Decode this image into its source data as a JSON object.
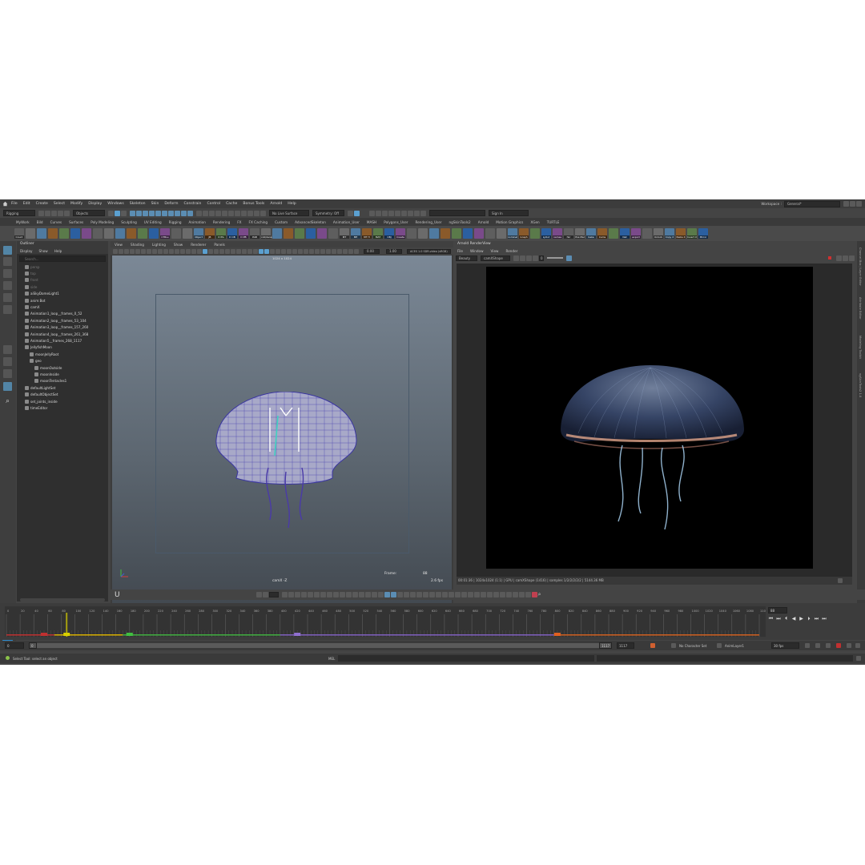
{
  "menubar": {
    "items": [
      "File",
      "Edit",
      "Create",
      "Select",
      "Modify",
      "Display",
      "Windows",
      "Skeleton",
      "Skin",
      "Deform",
      "Constrain",
      "Control",
      "Cache",
      "Bonus Tools",
      "Arnold",
      "Help"
    ],
    "workspace_label": "Workspace :",
    "workspace_value": "General*"
  },
  "statusline": {
    "menuset": "Rigging",
    "objects": "Objects",
    "live_surface": "No Live Surface",
    "symmetry": "Symmetry: Off",
    "sign_in": "Sign In"
  },
  "shelf_tabs": [
    "MyWork",
    "Bild",
    "Curves",
    "Surfaces",
    "Poly Modeling",
    "Sculpting",
    "UV Editing",
    "Rigging",
    "Animation",
    "Rendering",
    "FX",
    "FX Caching",
    "Custom",
    "AdvancedSkeleton",
    "Animation_User",
    "MASH",
    "Polygons_User",
    "Rendering_User",
    "ngSkinTools2",
    "Arnold",
    "Motion Graphics",
    "XGen",
    "TURTLE"
  ],
  "shelf_buttons": [
    "Count",
    "",
    "",
    "",
    "",
    "",
    "",
    "",
    "",
    "",
    "",
    "",
    "",
    "CTRLs",
    "",
    "",
    "Object",
    "JB",
    "D PG",
    "D OB",
    "D PB",
    "PAB",
    "coll/dens",
    "",
    "",
    "",
    "",
    "",
    "",
    "MT",
    "ME",
    "MT H",
    "MAT",
    "OBJ",
    "Create",
    "",
    "",
    "",
    "",
    "",
    "",
    "",
    "",
    "",
    "nominal",
    "Graph",
    "",
    "LyOut",
    "names",
    "hkr",
    "Pos Mel",
    "bake",
    "Cams",
    "",
    "Net",
    "export",
    "",
    "Unlock",
    "Copy X",
    "Paste X",
    "Invert X",
    "Mirror"
  ],
  "outliner": {
    "title": "Outliner",
    "menu": [
      "Display",
      "Show",
      "Help"
    ],
    "search_placeholder": "Search...",
    "items": [
      {
        "label": "persp",
        "dim": true,
        "indent": 1
      },
      {
        "label": "top",
        "dim": true,
        "indent": 1
      },
      {
        "label": "front",
        "dim": true,
        "indent": 1
      },
      {
        "label": "side",
        "dim": true,
        "indent": 1
      },
      {
        "label": "aiSkyDomeLight1",
        "dim": false,
        "indent": 1
      },
      {
        "label": "anim:Bot",
        "dim": false,
        "indent": 1
      },
      {
        "label": "camX",
        "dim": false,
        "indent": 1
      },
      {
        "label": "Animation1_loop__frames_0_52",
        "dim": false,
        "indent": 1
      },
      {
        "label": "Animation2_loop__frames_53_104",
        "dim": false,
        "indent": 1
      },
      {
        "label": "Animation3_loop__frames_157_260",
        "dim": false,
        "indent": 1
      },
      {
        "label": "Animation4_loop__frames_261_368",
        "dim": false,
        "indent": 1
      },
      {
        "label": "Animation5__frames_268_1117",
        "dim": false,
        "indent": 1
      },
      {
        "label": "JellyfishMoon",
        "dim": false,
        "indent": 1
      },
      {
        "label": "moonJellyRoot",
        "dim": false,
        "indent": 2
      },
      {
        "label": "geo",
        "dim": false,
        "indent": 2
      },
      {
        "label": "moonOutside",
        "dim": false,
        "indent": 3
      },
      {
        "label": "moonInside",
        "dim": false,
        "indent": 3
      },
      {
        "label": "moonTentacles1",
        "dim": false,
        "indent": 3
      },
      {
        "label": "defaultLightSet",
        "dim": false,
        "indent": 1
      },
      {
        "label": "defaultObjectSet",
        "dim": false,
        "indent": 1
      },
      {
        "label": "set_joints_inside",
        "dim": false,
        "indent": 1
      },
      {
        "label": "timeEditor",
        "dim": false,
        "indent": 1
      }
    ]
  },
  "viewport": {
    "menu": [
      "View",
      "Shading",
      "Lighting",
      "Show",
      "Renderer",
      "Panels"
    ],
    "exposure": "0.00",
    "gamma": "1.00",
    "colorspace": "ACES 1.0 SDR-video (sRGB)",
    "resolution": "1024 x 1024",
    "camera": "camX -Z",
    "frame_label": "Frame:",
    "frame_value": "88",
    "fps": "2.6 fps"
  },
  "renderview": {
    "title": "Arnold RenderView",
    "menu": [
      "File",
      "Window",
      "View",
      "Render"
    ],
    "aov": "Beauty",
    "camera": "camXShape",
    "exposure": "0",
    "status": "00:01:36 | 1024x1024 (1:1) | GPU | camXShape (1416) | samples 1/2/2/2/2/2 | 5144.36 MB"
  },
  "attr_strip": [
    "Channel Box / Layer Editor",
    "Attribute Editor",
    "Modeling Toolkit",
    "ngSkinTools2 1.0"
  ],
  "timeline": {
    "ticks": [
      0,
      20,
      40,
      60,
      80,
      100,
      120,
      140,
      160,
      180,
      200,
      220,
      240,
      260,
      280,
      300,
      320,
      340,
      360,
      380,
      400,
      420,
      440,
      460,
      480,
      500,
      520,
      540,
      560,
      580,
      600,
      620,
      640,
      660,
      680,
      700,
      720,
      740,
      760,
      780,
      800,
      820,
      840,
      860,
      880,
      900,
      920,
      940,
      960,
      980,
      1000,
      1020,
      1040,
      1060,
      1080,
      1100
    ],
    "start": 0,
    "end": 1117,
    "current_frame": 88,
    "current_frame_label": "88",
    "keys": [
      55,
      88,
      180,
      425,
      805
    ]
  },
  "range": {
    "start": "0",
    "start_inner": "0",
    "end_inner": "1117",
    "end": "1117",
    "character_set": "No Character Set",
    "anim_layer": "AnimLayer1",
    "fps": "30 fps"
  },
  "command": {
    "help_text": "Select Tool: select an object",
    "lang": "MEL"
  },
  "colors": {
    "selection_accent": "#5ba0d0",
    "maya_logo": "#2f8fd1",
    "timeline_current_frame": "#d8d000"
  }
}
